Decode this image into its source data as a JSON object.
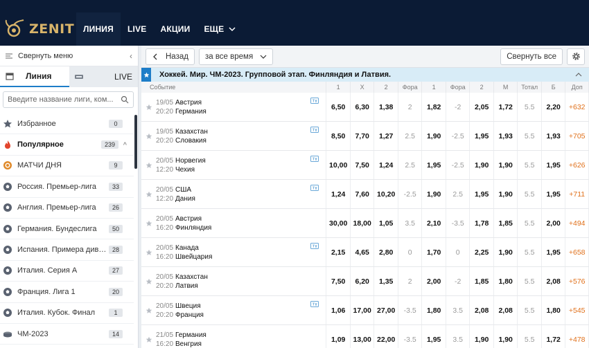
{
  "header": {
    "logo_text": "ZENIT",
    "nav": [
      {
        "label": "ЛИНИЯ",
        "active": true
      },
      {
        "label": "LIVE"
      },
      {
        "label": "АКЦИИ"
      },
      {
        "label": "ЕЩЕ",
        "has_dropdown": true
      }
    ],
    "colors": {
      "bg": "#0b1b35",
      "logo": "#d8b46a",
      "accent": "#1d7dc8"
    }
  },
  "sidebar": {
    "collapse_label": "Свернуть меню",
    "tabs": [
      {
        "label": "Линия",
        "icon": "calendar-icon",
        "active": true
      },
      {
        "label": "LIVE",
        "icon": "live-icon"
      }
    ],
    "search_placeholder": "Введите название лиги, ком...",
    "items": [
      {
        "label": "Избранное",
        "count": "0",
        "icon": "star-icon"
      },
      {
        "label": "Популярное",
        "count": "239",
        "icon": "fire-icon",
        "bold": true,
        "expanded": true
      },
      {
        "label": "МАТЧИ ДНЯ",
        "count": "9",
        "icon": "medal-icon"
      },
      {
        "label": "Россия. Премьер-лига",
        "count": "33",
        "icon": "soccer-ball-icon"
      },
      {
        "label": "Англия. Премьер-лига",
        "count": "26",
        "icon": "soccer-ball-icon"
      },
      {
        "label": "Германия. Бундеслига",
        "count": "50",
        "icon": "soccer-ball-icon"
      },
      {
        "label": "Испания. Примера дивиз...",
        "count": "28",
        "icon": "soccer-ball-icon"
      },
      {
        "label": "Италия. Серия А",
        "count": "27",
        "icon": "soccer-ball-icon"
      },
      {
        "label": "Франция. Лига 1",
        "count": "20",
        "icon": "soccer-ball-icon"
      },
      {
        "label": "Италия. Кубок. Финал",
        "count": "1",
        "icon": "soccer-ball-icon"
      },
      {
        "label": "ЧМ-2023",
        "count": "14",
        "icon": "hockey-puck-icon"
      }
    ]
  },
  "toolbar": {
    "back_label": "Назад",
    "period_label": "за все время",
    "collapse_all_label": "Свернуть все"
  },
  "league": {
    "title": "Хоккей. Мир. ЧМ-2023. Групповой этап. Финляндия и Латвия."
  },
  "table": {
    "columns": [
      "Событие",
      "1",
      "X",
      "2",
      "Фора",
      "1",
      "Фора",
      "2",
      "М",
      "Тотал",
      "Б",
      "Доп"
    ],
    "rows": [
      {
        "date": "19/05",
        "time": "20:20",
        "team1": "Австрия",
        "team2": "Германия",
        "tv": true,
        "odds": [
          "6,50",
          "6,30",
          "1,38",
          "2",
          "1,82",
          "-2",
          "2,05",
          "1,72",
          "5.5",
          "2,20",
          "+632"
        ]
      },
      {
        "date": "19/05",
        "time": "20:20",
        "team1": "Казахстан",
        "team2": "Словакия",
        "tv": true,
        "odds": [
          "8,50",
          "7,70",
          "1,27",
          "2.5",
          "1,90",
          "-2.5",
          "1,95",
          "1,93",
          "5.5",
          "1,93",
          "+705"
        ]
      },
      {
        "date": "20/05",
        "time": "12:20",
        "team1": "Норвегия",
        "team2": "Чехия",
        "tv": true,
        "odds": [
          "10,00",
          "7,50",
          "1,24",
          "2.5",
          "1,95",
          "-2.5",
          "1,90",
          "1,90",
          "5.5",
          "1,95",
          "+626"
        ]
      },
      {
        "date": "20/05",
        "time": "12:20",
        "team1": "США",
        "team2": "Дания",
        "tv": true,
        "odds": [
          "1,24",
          "7,60",
          "10,20",
          "-2.5",
          "1,90",
          "2.5",
          "1,95",
          "1,90",
          "5.5",
          "1,95",
          "+711"
        ]
      },
      {
        "date": "20/05",
        "time": "16:20",
        "team1": "Австрия",
        "team2": "Финляндия",
        "tv": false,
        "odds": [
          "30,00",
          "18,00",
          "1,05",
          "3.5",
          "2,10",
          "-3.5",
          "1,78",
          "1,85",
          "5.5",
          "2,00",
          "+494"
        ]
      },
      {
        "date": "20/05",
        "time": "16:20",
        "team1": "Канада",
        "team2": "Швейцария",
        "tv": true,
        "odds": [
          "2,15",
          "4,65",
          "2,80",
          "0",
          "1,70",
          "0",
          "2,25",
          "1,90",
          "5.5",
          "1,95",
          "+658"
        ]
      },
      {
        "date": "20/05",
        "time": "20:20",
        "team1": "Казахстан",
        "team2": "Латвия",
        "tv": false,
        "odds": [
          "7,50",
          "6,20",
          "1,35",
          "2",
          "2,00",
          "-2",
          "1,85",
          "1,80",
          "5.5",
          "2,08",
          "+576"
        ]
      },
      {
        "date": "20/05",
        "time": "20:20",
        "team1": "Швеция",
        "team2": "Франция",
        "tv": true,
        "odds": [
          "1,06",
          "17,00",
          "27,00",
          "-3.5",
          "1,80",
          "3.5",
          "2,08",
          "2,08",
          "5.5",
          "1,80",
          "+545"
        ]
      },
      {
        "date": "21/05",
        "time": "16:20",
        "team1": "Германия",
        "team2": "Венгрия",
        "tv": false,
        "odds": [
          "1,09",
          "13,00",
          "22,00",
          "-3.5",
          "1,95",
          "3.5",
          "1,90",
          "1,90",
          "5.5",
          "1,72",
          "+478"
        ]
      }
    ]
  }
}
